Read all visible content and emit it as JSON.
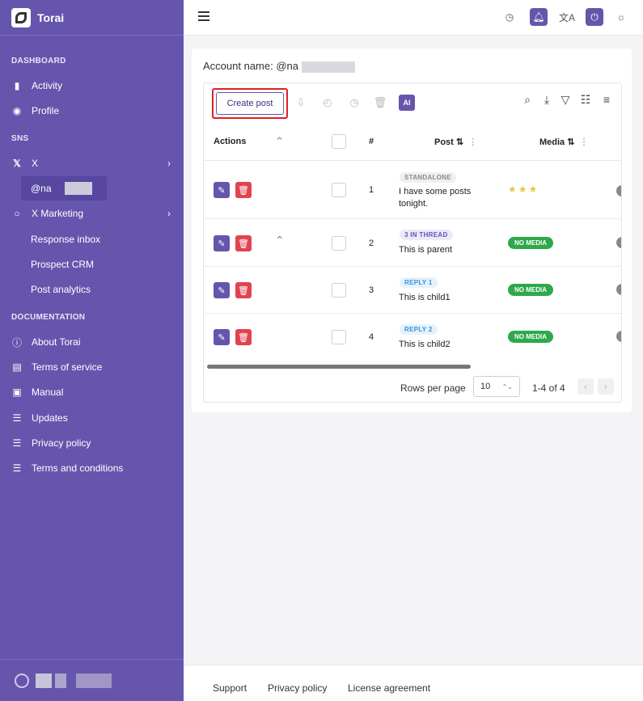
{
  "app": {
    "name": "Torai"
  },
  "sidebar": {
    "sections": {
      "dashboard": "DASHBOARD",
      "sns": "SNS",
      "documentation": "DOCUMENTATION"
    },
    "items": {
      "activity": "Activity",
      "profile": "Profile",
      "x": "X",
      "account": "@na",
      "x_marketing": "X Marketing",
      "response_inbox": "Response inbox",
      "prospect_crm": "Prospect CRM",
      "post_analytics": "Post analytics",
      "about": "About Torai",
      "terms_service": "Terms of service",
      "manual": "Manual",
      "updates": "Updates",
      "privacy": "Privacy policy",
      "terms_conditions": "Terms and conditions"
    }
  },
  "main": {
    "account_label": "Account name: @na",
    "toolbar": {
      "create_post": "Create post",
      "ai": "AI"
    },
    "columns": {
      "actions": "Actions",
      "num": "#",
      "post": "Post ⇅",
      "media": "Media ⇅"
    },
    "rows": [
      {
        "num": "1",
        "tag": "STANDALONE",
        "text": "I have some posts tonight.",
        "media": ""
      },
      {
        "num": "2",
        "tag": "3 IN THREAD",
        "text": "This is parent",
        "media": "NO MEDIA"
      },
      {
        "num": "3",
        "tag": "REPLY 1",
        "text": "This is child1",
        "media": "NO MEDIA"
      },
      {
        "num": "4",
        "tag": "REPLY 2",
        "text": "This is child2",
        "media": "NO MEDIA"
      }
    ],
    "pager": {
      "rows_label": "Rows per page",
      "rows_value": "10",
      "range": "1-4 of 4"
    }
  },
  "footer": {
    "support": "Support",
    "privacy": "Privacy policy",
    "license": "License agreement"
  }
}
